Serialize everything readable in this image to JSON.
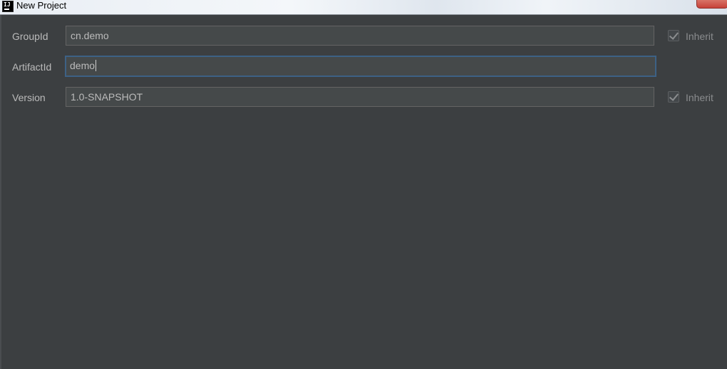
{
  "window": {
    "title": "New Project"
  },
  "form": {
    "groupId": {
      "label": "GroupId",
      "value": "cn.demo",
      "inherit_label": "Inherit",
      "inherit_checked": true
    },
    "artifactId": {
      "label": "ArtifactId",
      "value": "demo"
    },
    "version": {
      "label": "Version",
      "value": "1.0-SNAPSHOT",
      "inherit_label": "Inherit",
      "inherit_checked": true
    }
  },
  "icons": {
    "app": "intellij-idea-icon",
    "check": "checkmark-icon"
  },
  "colors": {
    "background": "#3c3f41",
    "field_bg": "#45494a",
    "focus_border": "#3d6185",
    "text": "#bbbbbb"
  }
}
